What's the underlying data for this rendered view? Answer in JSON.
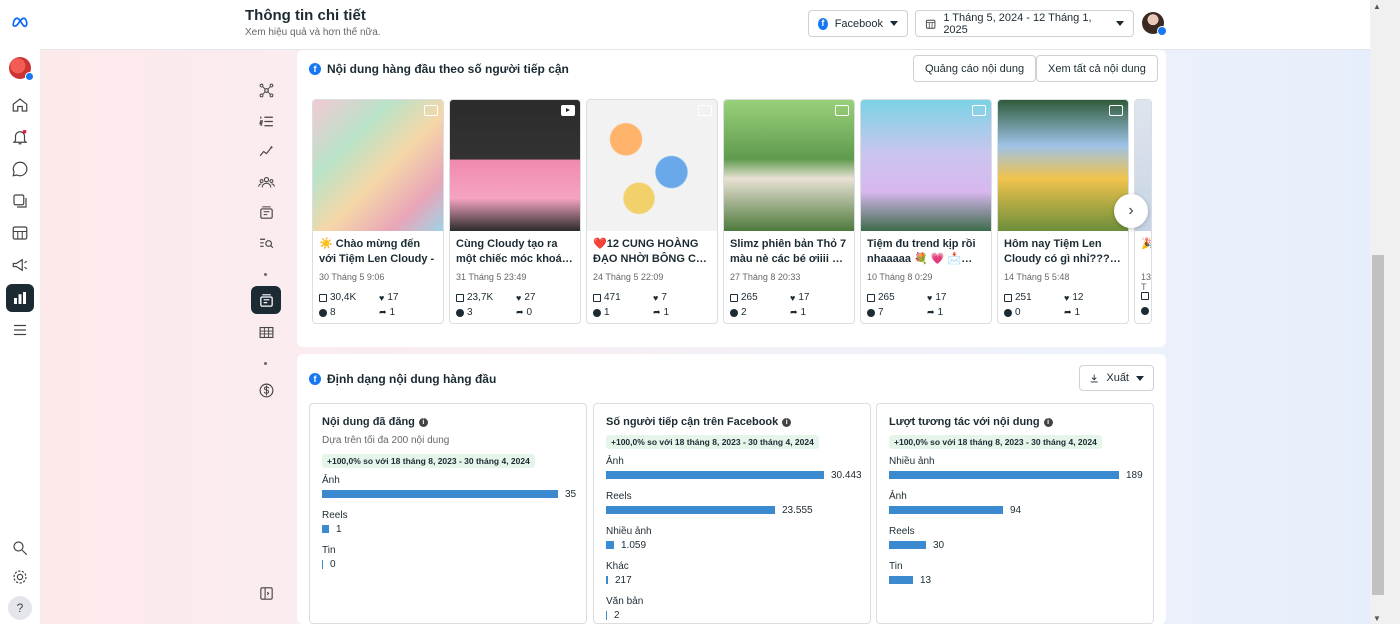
{
  "header": {
    "title": "Thông tin chi tiết",
    "subtitle": "Xem hiệu quả và hơn thế nữa.",
    "platform_label": "Facebook",
    "date_range": "1 Tháng 5, 2024 - 12 Tháng 1, 2025"
  },
  "top_content": {
    "title": "Nội dung hàng đầu theo số người tiếp cận",
    "ads_button": "Quảng cáo nội dung",
    "view_all_button": "Xem tất cả nội dung",
    "posts": [
      {
        "title": "☀️ Chào mừng đến với Tiệm Len Cloudy - n…",
        "date": "30 Tháng 5 9:06",
        "reach": "30,4K",
        "likes": "17",
        "comments": "8",
        "shares": "1",
        "type": "photo"
      },
      {
        "title": "Cùng Cloudy tạo ra một chiếc móc khoá…",
        "date": "31 Tháng 5 23:49",
        "reach": "23,7K",
        "likes": "27",
        "comments": "3",
        "shares": "0",
        "type": "video"
      },
      {
        "title": "❤️12 CUNG HOÀNG ĐẠO NHỜI BÔNG C…",
        "date": "24 Tháng 5 22:09",
        "reach": "471",
        "likes": "7",
        "comments": "1",
        "shares": "1",
        "type": "photo"
      },
      {
        "title": "Slimz phiên bản Thỏ 7 màu nè các bé ơiiii …",
        "date": "27 Tháng 8 20:33",
        "reach": "265",
        "likes": "17",
        "comments": "2",
        "shares": "1",
        "type": "photo"
      },
      {
        "title": "Tiệm đu trend kịp rồi nhaaaaa 💐 💗 📩…",
        "date": "10 Tháng 8 0:29",
        "reach": "265",
        "likes": "17",
        "comments": "7",
        "shares": "1",
        "type": "photo"
      },
      {
        "title": "Hôm nay Tiệm Len Cloudy có gì nhỉ???…",
        "date": "14 Tháng 5 5:48",
        "reach": "251",
        "likes": "12",
        "comments": "0",
        "shares": "1",
        "type": "photo"
      },
      {
        "title": "🎉 đế…",
        "date": "13 T",
        "reach": "",
        "likes": "",
        "comments": "",
        "shares": "",
        "type": "photo"
      }
    ]
  },
  "formats": {
    "title": "Định dạng nội dung hàng đầu",
    "export_button": "Xuất",
    "panels": [
      {
        "title": "Nội dung đã đăng",
        "subtitle": "Dựa trên tối đa 200 nội dung",
        "growth": "+100,0% so với 18 tháng 8, 2023 - 30 tháng 4, 2024",
        "rows": [
          {
            "label": "Ảnh",
            "value": 35,
            "display": "35"
          },
          {
            "label": "Reels",
            "value": 1,
            "display": "1"
          },
          {
            "label": "Tin",
            "value": 0,
            "display": "0"
          }
        ]
      },
      {
        "title": "Số người tiếp cận trên Facebook",
        "subtitle": "",
        "growth": "+100,0% so với 18 tháng 8, 2023 - 30 tháng 4, 2024",
        "rows": [
          {
            "label": "Ảnh",
            "value": 30443,
            "display": "30.443"
          },
          {
            "label": "Reels",
            "value": 23555,
            "display": "23.555"
          },
          {
            "label": "Nhiều ảnh",
            "value": 1059,
            "display": "1.059"
          },
          {
            "label": "Khác",
            "value": 217,
            "display": "217"
          },
          {
            "label": "Văn bản",
            "value": 2,
            "display": "2"
          }
        ]
      },
      {
        "title": "Lượt tương tác với nội dung",
        "subtitle": "",
        "growth": "+100,0% so với 18 tháng 8, 2023 - 30 tháng 4, 2024",
        "rows": [
          {
            "label": "Nhiều ảnh",
            "value": 189,
            "display": "189"
          },
          {
            "label": "Ảnh",
            "value": 94,
            "display": "94"
          },
          {
            "label": "Reels",
            "value": 30,
            "display": "30"
          },
          {
            "label": "Tin",
            "value": 13,
            "display": "13"
          }
        ]
      }
    ]
  },
  "colors": {
    "accent": "#1877f2",
    "bar": "#3b8ad0",
    "dark": "#1c2b33",
    "growth_bg": "#e5f5ea"
  }
}
